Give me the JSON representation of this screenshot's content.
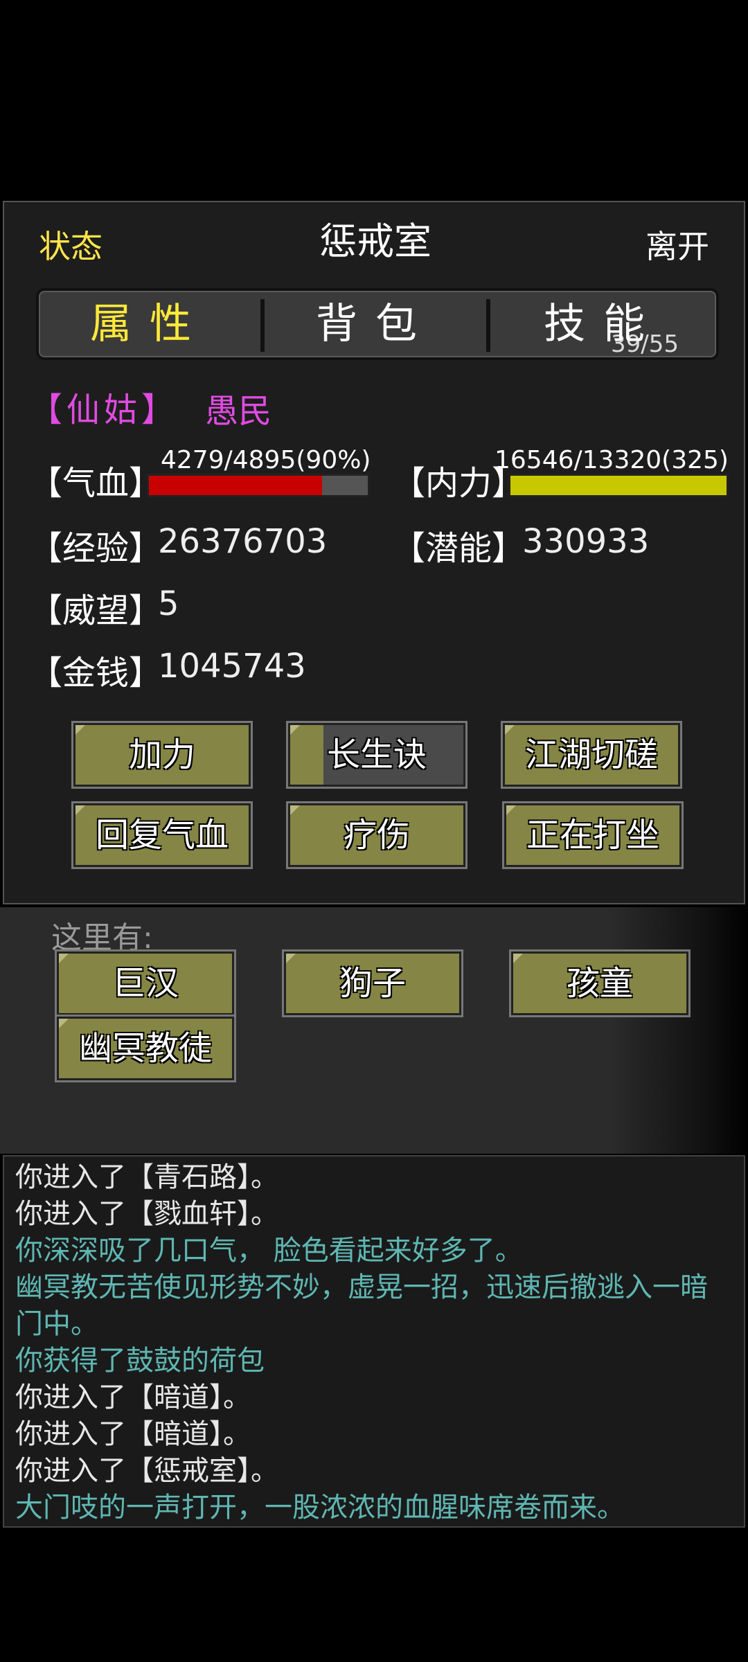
{
  "header": {
    "status_label": "状态",
    "room_name": "惩戒室",
    "leave_label": "离开"
  },
  "tabs": {
    "attributes": "属性",
    "bag": "背包",
    "bag_count": "39/55",
    "skills": "技能"
  },
  "character": {
    "title": "【仙姑】",
    "rank": "愚民"
  },
  "stats": {
    "hp_label": "【气血】",
    "hp_text": "4279/4895(90%)",
    "hp_current": 4279,
    "hp_max": 4895,
    "hp_fill_fraction": 0.79,
    "mp_label": "【内力】",
    "mp_text": "16546/13320(325)",
    "mp_fill_fraction": 1.0,
    "exp_label": "【经验】",
    "exp_value": "26376703",
    "potential_label": "【潜能】",
    "potential_value": "330933",
    "prestige_label": "【威望】",
    "prestige_value": "5",
    "money_label": "【金钱】",
    "money_value": "1045743"
  },
  "actions": {
    "jiali": "加力",
    "changsheng": "长生诀",
    "spar": "江湖切磋",
    "heal_hp": "回复气血",
    "treat": "疗伤",
    "meditate": "正在打坐",
    "changsheng_progress": 0.19
  },
  "scene": {
    "here_label": "这里有:",
    "npcs": [
      "巨汉",
      "狗子",
      "孩童",
      "幽冥教徒"
    ]
  },
  "log": [
    {
      "text": "你进入了【青石路】。",
      "highlight": false
    },
    {
      "text": "你进入了【戮血轩】。",
      "highlight": false
    },
    {
      "text": "你深深吸了几口气， 脸色看起来好多了。",
      "highlight": true
    },
    {
      "text": "幽冥教无苦使见形势不妙，虚晃一招，迅速后撤逃入一暗门中。",
      "highlight": true
    },
    {
      "text": "你获得了鼓鼓的荷包",
      "highlight": true
    },
    {
      "text": "你进入了【暗道】。",
      "highlight": false
    },
    {
      "text": "你进入了【暗道】。",
      "highlight": false
    },
    {
      "text": "你进入了【惩戒室】。",
      "highlight": false
    },
    {
      "text": "大门吱的一声打开，一股浓浓的血腥味席卷而来。",
      "highlight": true
    }
  ],
  "colors": {
    "highlight_text": "#5fb7b3",
    "title_color": "#e04be0",
    "status_yellow": "#ffe54a"
  }
}
